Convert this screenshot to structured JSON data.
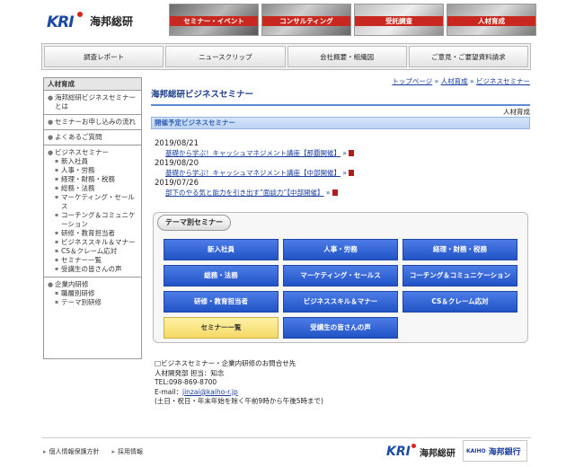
{
  "header": {
    "logo_mark": "KRI",
    "logo_name": "海邦総研",
    "banners": [
      {
        "label": "セミナー・イベント"
      },
      {
        "label": "コンサルティング"
      },
      {
        "label": "受託調査"
      },
      {
        "label": "人材育成"
      }
    ],
    "nav": [
      "調査レポート",
      "ニュースクリップ",
      "会社概要・組織図",
      "ご意見・ご要望資料請求"
    ]
  },
  "sidebar": {
    "heading": "人材育成",
    "sections": [
      {
        "items": [
          {
            "label": "海邦総研ビジネスセミナーとは"
          }
        ]
      },
      {
        "items": [
          {
            "label": "セミナーお申し込みの流れ"
          }
        ]
      },
      {
        "items": [
          {
            "label": "よくあるご質問"
          }
        ]
      },
      {
        "items": [
          {
            "label": "ビジネスセミナー"
          }
        ],
        "subs": [
          "新入社員",
          "人事・労務",
          "経理・財務・税務",
          "総務・法務",
          "マーケティング・セールス",
          "コーチング＆コミュニケーション",
          "研修・教育担当者",
          "ビジネススキル＆マナー",
          "CS＆クレーム応対",
          "セミナー一覧",
          "受講生の皆さんの声"
        ]
      },
      {
        "items": [
          {
            "label": "企業内研修"
          }
        ],
        "subs": [
          "職層別研修",
          "テーマ別研修"
        ]
      }
    ]
  },
  "main": {
    "breadcrumb": [
      "トップページ",
      "人材育成",
      "ビジネスセミナー"
    ],
    "breadcrumb_sep": "»",
    "title": "海邦総研ビジネスセミナー",
    "category": "人材育成",
    "section_heading": "開催予定ビジネスセミナー",
    "events": [
      {
        "date": "2019/08/21",
        "title": "基礎から学ぶ！キャッシュマネジメント講座【那覇開催】",
        "suffix": "»"
      },
      {
        "date": "2019/08/20",
        "title": "基礎から学ぶ！キャッシュマネジメント講座【中部開催】",
        "suffix": "»"
      },
      {
        "date": "2019/07/26",
        "title": "部下のやる気と能力を引き出す”面談力”【中部開催】",
        "suffix": "»"
      }
    ],
    "theme_heading": "テーマ別セミナー",
    "theme_buttons": [
      {
        "label": "新入社員",
        "style": "blue"
      },
      {
        "label": "人事・労務",
        "style": "blue"
      },
      {
        "label": "経理・財務・税務",
        "style": "blue"
      },
      {
        "label": "総務・法務",
        "style": "blue"
      },
      {
        "label": "マーケティング・セールス",
        "style": "blue"
      },
      {
        "label": "コーチング＆コミュニケーション",
        "style": "blue"
      },
      {
        "label": "研修・教育担当者",
        "style": "blue"
      },
      {
        "label": "ビジネススキル＆マナー",
        "style": "blue"
      },
      {
        "label": "CS＆クレーム応対",
        "style": "blue"
      },
      {
        "label": "セミナー一覧",
        "style": "yellow"
      },
      {
        "label": "受講生の皆さんの声",
        "style": "blue"
      }
    ],
    "contact": {
      "line1": "□ビジネスセミナー・企業内研修のお問合せ先",
      "line2": "人材開発部 担当：知念",
      "tel": "TEL:098-869-8700",
      "email_label": "E-mail：",
      "email": "jinzai@kaiho-r.jp",
      "hours": "(土日・祝日・年末年始を除く午前9時から午後5時まで)"
    }
  },
  "footer": {
    "links": [
      "個人情報保護方針",
      "採用情報"
    ],
    "logo_mark": "KRI",
    "logo_name": "海邦総研",
    "bank_en": "KAIHO",
    "bank_jp": "海邦銀行"
  },
  "colors": {
    "accent_blue": "#2253c6",
    "link_blue": "#1a3ea0",
    "banner_red": "#c8281f",
    "highlight_yellow": "#f6d864"
  }
}
